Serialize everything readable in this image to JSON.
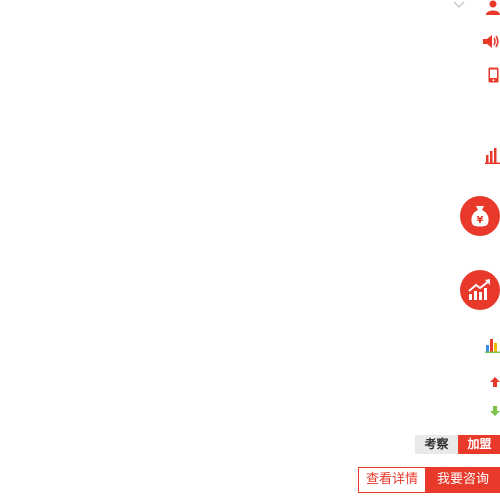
{
  "sidebar": {
    "icons": [
      {
        "name": "chevron-down-icon"
      },
      {
        "name": "user-icon"
      },
      {
        "name": "speaker-icon"
      },
      {
        "name": "phone-icon"
      },
      {
        "name": "bar-chart-icon"
      },
      {
        "name": "money-bag-icon"
      },
      {
        "name": "growth-chart-icon"
      },
      {
        "name": "colored-bar-chart-icon"
      },
      {
        "name": "arrow-up-icon"
      },
      {
        "name": "arrow-down-icon"
      }
    ],
    "colors": {
      "accent": "#e8392b",
      "green": "#7cc34a",
      "gray": "#e9e9e9"
    }
  },
  "tags": {
    "inspect_label": "考察",
    "join_label": "加盟"
  },
  "actions": {
    "details_label": "查看详情",
    "consult_label": "我要咨询"
  }
}
